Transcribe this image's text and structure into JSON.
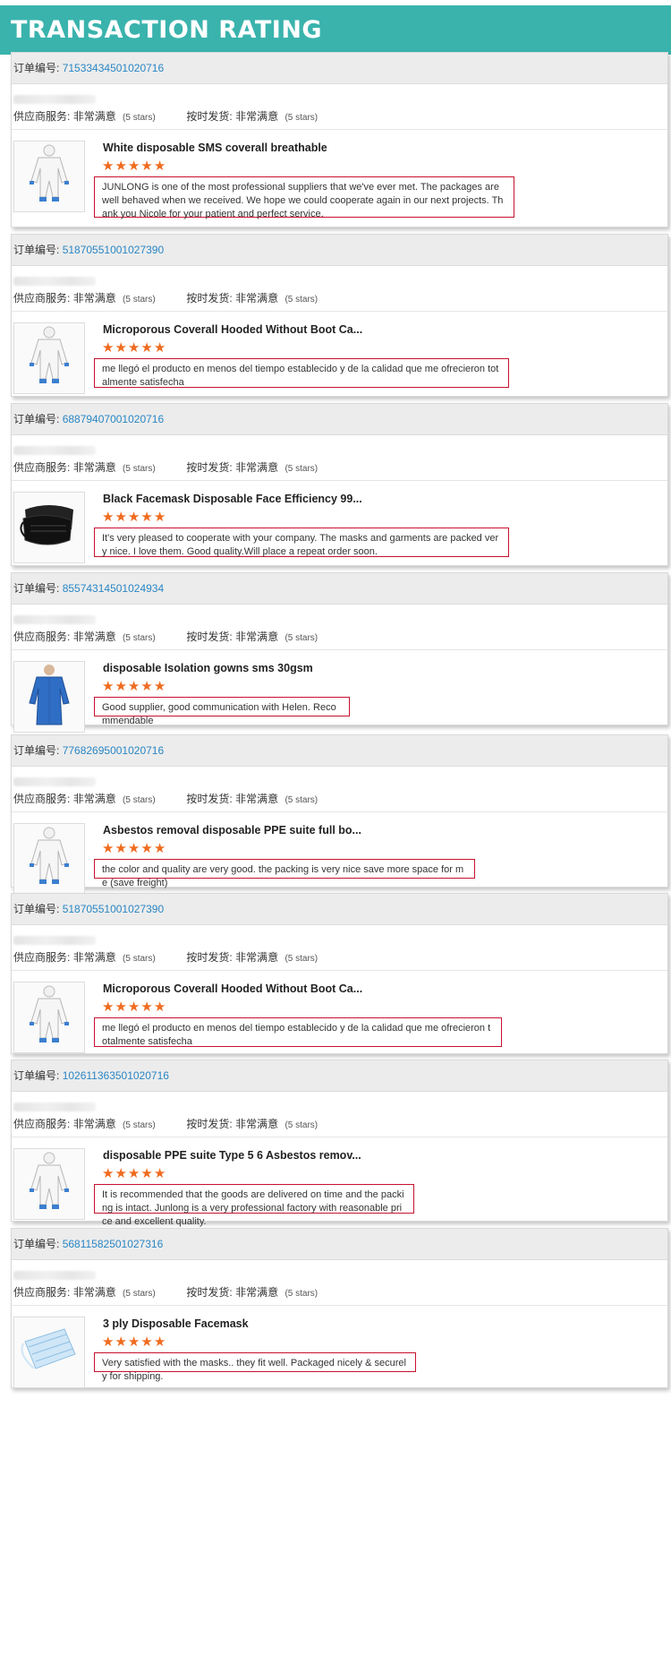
{
  "header": {
    "title": "TRANSACTION RATING"
  },
  "labels": {
    "order_prefix": "订单编号:",
    "supplier_service": "供应商服务:",
    "on_time": "按时发货:",
    "rating_value": "非常满意",
    "stars_note": "(5 stars)"
  },
  "colors": {
    "banner": "#3ab3ad",
    "star": "#ef6b1f",
    "comment_border": "#c8102e",
    "order_link": "#2a86c4"
  },
  "reviews": [
    {
      "order_number": "71533434501020716",
      "product_title": "White disposable SMS coverall breathable",
      "stars": 5,
      "comment": "JUNLONG is one of the most professional suppliers that we've ever met. The packages are well behaved when we received. We hope we could cooperate again in our next projects. Thank you Nicole for your patient and perfect service.",
      "thumb_icon": "white-coverall-icon"
    },
    {
      "order_number": "51870551001027390",
      "product_title": "Microporous Coverall Hooded Without Boot Ca...",
      "stars": 5,
      "comment": "me llegó el producto en menos del tiempo establecido y de la calidad que me ofrecieron totalmente satisfecha",
      "thumb_icon": "white-coverall-icon"
    },
    {
      "order_number": "68879407001020716",
      "product_title": "Black Facemask Disposable Face Efficiency 99...",
      "stars": 5,
      "comment": "It's very pleased to cooperate with your company. The masks and garments are packed very nice. I love them. Good quality.Will place a repeat order soon.",
      "thumb_icon": "black-facemask-icon"
    },
    {
      "order_number": "85574314501024934",
      "product_title": "disposable Isolation gowns sms 30gsm",
      "stars": 5,
      "comment": "Good supplier, good communication with Helen.  Recommendable",
      "thumb_icon": "blue-gown-icon"
    },
    {
      "order_number": "77682695001020716",
      "product_title": "Asbestos removal disposable PPE suite full bo...",
      "stars": 5,
      "comment": "the color and quality are very good. the packing is very nice save more space for me (save freight)",
      "thumb_icon": "white-coverall-icon"
    },
    {
      "order_number": "51870551001027390",
      "product_title": "Microporous Coverall Hooded Without Boot Ca...",
      "stars": 5,
      "comment": "me llegó el producto en menos del tiempo establecido y de la calidad que me ofrecieron totalmente satisfecha",
      "thumb_icon": "white-coverall-icon"
    },
    {
      "order_number": "102611363501020716",
      "product_title": "disposable PPE suite Type 5 6 Asbestos remov...",
      "stars": 5,
      "comment": "It is recommended that the goods are delivered on time and the packing is intact. Junlong is a very professional factory with reasonable price and excellent quality.",
      "thumb_icon": "white-coverall-icon"
    },
    {
      "order_number": "56811582501027316",
      "product_title": "3 ply Disposable Facemask",
      "stars": 5,
      "comment": "Very satisfied with the masks.. they fit well.  Packaged nicely & securely for shipping.",
      "thumb_icon": "blue-facemask-icon"
    }
  ]
}
